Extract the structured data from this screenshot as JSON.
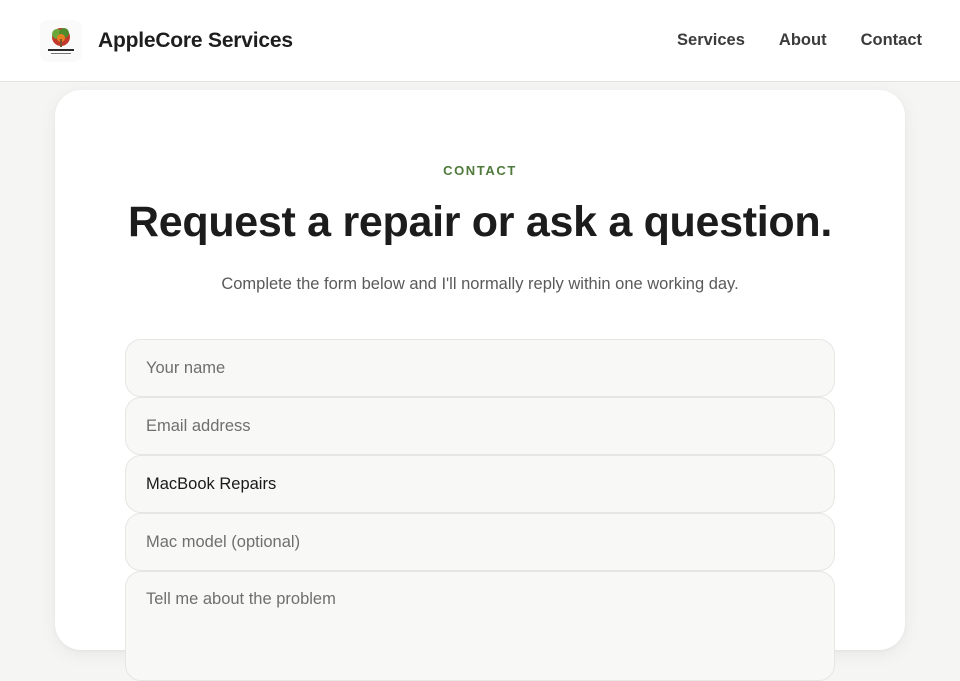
{
  "header": {
    "brand_name": "AppleCore Services",
    "logo_icon": "apple-tree-logo-icon",
    "nav": [
      {
        "label": "Services"
      },
      {
        "label": "About"
      },
      {
        "label": "Contact"
      }
    ]
  },
  "contact": {
    "eyebrow": "CONTACT",
    "headline": "Request a repair or ask a question.",
    "subtitle": "Complete the form below and I'll normally reply within one working day.",
    "fields": {
      "name_placeholder": "Your name",
      "email_placeholder": "Email address",
      "service_value": "MacBook Repairs",
      "model_placeholder": "Mac model (optional)",
      "message_placeholder": "Tell me about the problem"
    }
  },
  "colors": {
    "accent_green": "#4f7a3c",
    "page_background": "#f5f5f3",
    "card_background": "#ffffff"
  }
}
